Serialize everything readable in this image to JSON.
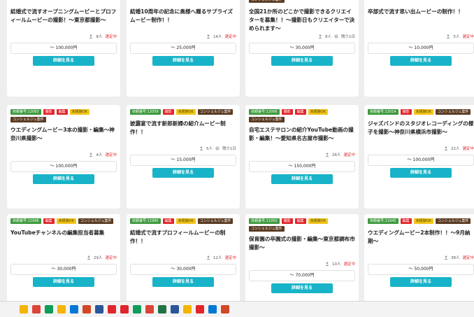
{
  "cards": [
    {
      "tags": [],
      "title": "結婚式で流すオープニングムービーとプロフィールムービーの撮影！～東京都撮影～",
      "people": "8人",
      "remaining": "",
      "status": "選定中",
      "price": "～ 100,000円",
      "button": "詳細を見る"
    },
    {
      "tags": [],
      "title": "結婚10周年の記念に奥様へ贈るサプライズムービー制作！！",
      "people": "14人",
      "remaining": "",
      "status": "選定中",
      "price": "～ 25,000円",
      "button": "詳細を見る"
    },
    {
      "tags": [
        {
          "label": "コンシェルジュ案件",
          "color": "brown"
        }
      ],
      "title": "全国21か所のどこかで撮影できるクリエイターを募集！！～撮影日もクリエイターで決められます～",
      "people": "8人",
      "remaining": "残り1日",
      "status": "",
      "price": "～ 30,000円",
      "button": "詳細を見る"
    },
    {
      "tags": [],
      "title": "卒部式で流す思い出ムービーの制作！！",
      "people": "5人",
      "remaining": "",
      "status": "選定中",
      "price": "～ 10,000円",
      "button": "詳細を見る"
    },
    {
      "tags": [
        {
          "label": "依頼番号:12093",
          "color": "green"
        },
        {
          "label": "撮影",
          "color": "red"
        },
        {
          "label": "編集",
          "color": "red"
        },
        {
          "label": "未経験OK",
          "color": "yellow"
        },
        {
          "label": "コンシェルジュ案件",
          "color": "brown"
        }
      ],
      "title": "ウエディングムービー3本の撮影・編集～神奈川県撮影～",
      "people": "4人",
      "remaining": "",
      "status": "選定中",
      "price": "～ 100,000円",
      "button": "詳細を見る"
    },
    {
      "tags": [
        {
          "label": "依頼番号:12059",
          "color": "green"
        },
        {
          "label": "撮影",
          "color": "red"
        },
        {
          "label": "未経験OK",
          "color": "yellow"
        },
        {
          "label": "コンシェルジュ案件",
          "color": "brown"
        }
      ],
      "title": "披露宴で流す新郎新婦の紹介ムービー制作！！",
      "people": "5人",
      "remaining": "残り1日",
      "status": "",
      "price": "～ 15,000円",
      "button": "詳細を見る"
    },
    {
      "tags": [
        {
          "label": "依頼番号:12006",
          "color": "green"
        },
        {
          "label": "撮影",
          "color": "red"
        },
        {
          "label": "編集",
          "color": "red"
        },
        {
          "label": "未経験OK",
          "color": "yellow"
        },
        {
          "label": "コンシェルジュ案件",
          "color": "brown"
        }
      ],
      "title": "自宅エステサロンの紹介YouTube動画の撮影・編集！～愛知県名古屋市撮影～",
      "people": "26人",
      "remaining": "",
      "status": "選定中",
      "price": "～ 150,000円",
      "button": "詳細を見る"
    },
    {
      "tags": [
        {
          "label": "依頼番号:12014",
          "color": "green"
        },
        {
          "label": "撮影",
          "color": "red"
        },
        {
          "label": "未経験OK",
          "color": "yellow"
        },
        {
          "label": "コンシェルジュ案件",
          "color": "brown"
        }
      ],
      "title": "ジャズバンドのスタジオレコーディングの様子を撮影～神奈川県横浜市撮影～",
      "people": "22人",
      "remaining": "",
      "status": "選定中",
      "price": "～ 100,000円",
      "button": "詳細を見る"
    },
    {
      "tags": [
        {
          "label": "依頼番号:11998",
          "color": "green"
        },
        {
          "label": "編集",
          "color": "red"
        },
        {
          "label": "未経験OK",
          "color": "yellow"
        },
        {
          "label": "コンシェルジュ案件",
          "color": "brown"
        }
      ],
      "title": "YouTubeチャンネルの編集担当者募集",
      "people": "29人",
      "remaining": "",
      "status": "選定中",
      "price": "～ 30,000円",
      "button": "詳細を見る"
    },
    {
      "tags": [
        {
          "label": "依頼番号:11990",
          "color": "green"
        },
        {
          "label": "編集",
          "color": "red"
        },
        {
          "label": "未経験OK",
          "color": "yellow"
        },
        {
          "label": "コンシェルジュ案件",
          "color": "brown"
        }
      ],
      "title": "結婚式で流すプロフィールムービーの制作！！",
      "people": "12人",
      "remaining": "",
      "status": "選定中",
      "price": "～ 30,000円",
      "button": "詳細を見る"
    },
    {
      "tags": [
        {
          "label": "依頼番号:11950",
          "color": "green"
        },
        {
          "label": "撮影",
          "color": "red"
        },
        {
          "label": "編集",
          "color": "red"
        },
        {
          "label": "未経験OK",
          "color": "yellow"
        },
        {
          "label": "コンシェルジュ案件",
          "color": "brown"
        }
      ],
      "title": "保育園の卒園式の撮影・編集～東京都調布市撮影～",
      "people": "10人",
      "remaining": "",
      "status": "選定中",
      "price": "～ 70,000円",
      "button": "詳細を見る"
    },
    {
      "tags": [
        {
          "label": "依頼番号:11945",
          "color": "green"
        },
        {
          "label": "編集",
          "color": "red"
        },
        {
          "label": "未経験OK",
          "color": "yellow"
        },
        {
          "label": "コンシェルジュ案件",
          "color": "brown"
        }
      ],
      "title": "ウエディングムービー2本制作！！～9月納期～",
      "people": "38人",
      "remaining": "",
      "status": "選定中",
      "price": "～ 50,000円",
      "button": "詳細を見る"
    }
  ],
  "taskbar": {
    "icons": [
      {
        "name": "file-explorer-icon",
        "color": "#f4b400"
      },
      {
        "name": "chrome-icon",
        "color": "#db4437"
      },
      {
        "name": "edge-icon",
        "color": "#0f9d58"
      },
      {
        "name": "folder-icon",
        "color": "#f4b400"
      },
      {
        "name": "outlook-icon",
        "color": "#0078d4"
      },
      {
        "name": "powerpoint-icon",
        "color": "#d24726"
      },
      {
        "name": "word-icon",
        "color": "#2b579a"
      },
      {
        "name": "flag-icon",
        "color": "#e0262b"
      },
      {
        "name": "check-icon",
        "color": "#e0262b"
      },
      {
        "name": "drive-icon",
        "color": "#0f9d58"
      },
      {
        "name": "chrome-icon",
        "color": "#db4437"
      },
      {
        "name": "excel-icon",
        "color": "#217346"
      },
      {
        "name": "word-icon",
        "color": "#2b579a"
      },
      {
        "name": "drive-icon",
        "color": "#f4b400"
      },
      {
        "name": "check-icon",
        "color": "#e0262b"
      },
      {
        "name": "app-icon",
        "color": "#0078d4"
      },
      {
        "name": "app-icon",
        "color": "#d24726"
      }
    ]
  }
}
